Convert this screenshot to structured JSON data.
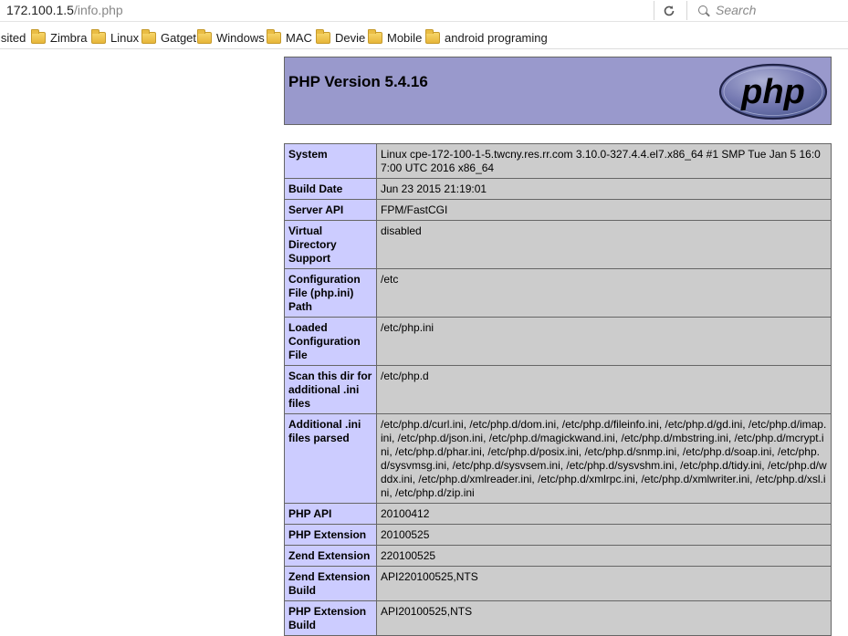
{
  "browser": {
    "url_host": "172.100.1.5",
    "url_path": "/info.php",
    "search_placeholder": "Search",
    "bookmarks": [
      {
        "label": "isited",
        "icon": "none"
      },
      {
        "label": "Zimbra",
        "icon": "folder-icon"
      },
      {
        "label": "Linux",
        "icon": "folder-icon"
      },
      {
        "label": "Gatget",
        "icon": "folder-icon"
      },
      {
        "label": "Windows",
        "icon": "folder-icon"
      },
      {
        "label": "MAC",
        "icon": "folder-icon"
      },
      {
        "label": "Devie",
        "icon": "folder-icon"
      },
      {
        "label": "Mobile",
        "icon": "folder-icon"
      },
      {
        "label": "android programing",
        "icon": "folder-icon"
      }
    ]
  },
  "php": {
    "title": "PHP Version 5.4.16",
    "logo_text": "php",
    "colors": {
      "header_bg": "#9999cc",
      "label_bg": "#ccccff",
      "value_bg": "#cccccc",
      "border": "#666666"
    },
    "rows": [
      {
        "label": "System",
        "value": "Linux cpe-172-100-1-5.twcny.res.rr.com 3.10.0-327.4.4.el7.x86_64 #1 SMP Tue Jan 5 16:07:00 UTC 2016 x86_64"
      },
      {
        "label": "Build Date",
        "value": "Jun 23 2015 21:19:01"
      },
      {
        "label": "Server API",
        "value": "FPM/FastCGI"
      },
      {
        "label": "Virtual Directory Support",
        "value": "disabled"
      },
      {
        "label": "Configuration File (php.ini) Path",
        "value": "/etc"
      },
      {
        "label": "Loaded Configuration File",
        "value": "/etc/php.ini"
      },
      {
        "label": "Scan this dir for additional .ini files",
        "value": "/etc/php.d"
      },
      {
        "label": "Additional .ini files parsed",
        "value": "/etc/php.d/curl.ini, /etc/php.d/dom.ini, /etc/php.d/fileinfo.ini, /etc/php.d/gd.ini, /etc/php.d/imap.ini, /etc/php.d/json.ini, /etc/php.d/magickwand.ini, /etc/php.d/mbstring.ini, /etc/php.d/mcrypt.ini, /etc/php.d/phar.ini, /etc/php.d/posix.ini, /etc/php.d/snmp.ini, /etc/php.d/soap.ini, /etc/php.d/sysvmsg.ini, /etc/php.d/sysvsem.ini, /etc/php.d/sysvshm.ini, /etc/php.d/tidy.ini, /etc/php.d/wddx.ini, /etc/php.d/xmlreader.ini, /etc/php.d/xmlrpc.ini, /etc/php.d/xmlwriter.ini, /etc/php.d/xsl.ini, /etc/php.d/zip.ini"
      },
      {
        "label": "PHP API",
        "value": "20100412"
      },
      {
        "label": "PHP Extension",
        "value": "20100525"
      },
      {
        "label": "Zend Extension",
        "value": "220100525"
      },
      {
        "label": "Zend Extension Build",
        "value": "API220100525,NTS"
      },
      {
        "label": "PHP Extension Build",
        "value": "API20100525,NTS"
      }
    ]
  }
}
